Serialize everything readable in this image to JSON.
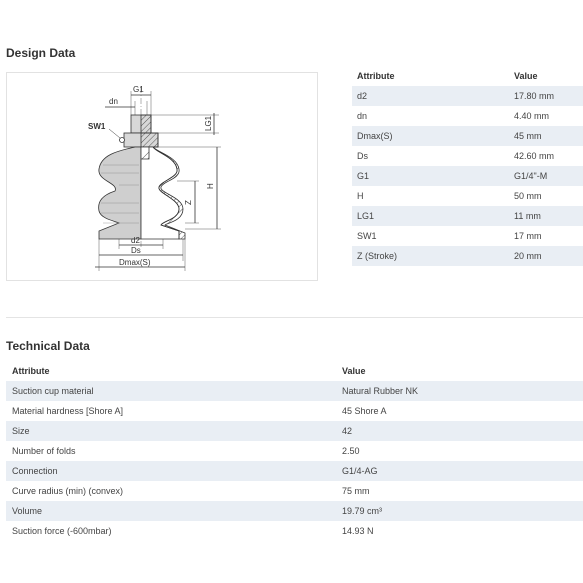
{
  "design": {
    "title": "Design Data",
    "header": {
      "attribute": "Attribute",
      "value": "Value"
    },
    "rows": [
      {
        "attribute": "d2",
        "value": "17.80 mm"
      },
      {
        "attribute": "dn",
        "value": "4.40 mm"
      },
      {
        "attribute": "Dmax(S)",
        "value": "45 mm"
      },
      {
        "attribute": "Ds",
        "value": "42.60 mm"
      },
      {
        "attribute": "G1",
        "value": "G1/4\"-M"
      },
      {
        "attribute": "H",
        "value": "50 mm"
      },
      {
        "attribute": "LG1",
        "value": "11 mm"
      },
      {
        "attribute": "SW1",
        "value": "17 mm"
      },
      {
        "attribute": "Z (Stroke)",
        "value": "20 mm"
      }
    ],
    "diagram_labels": {
      "g1": "G1",
      "dn": "dn",
      "sw1": "SW1",
      "lg1": "LG1",
      "h": "H",
      "z": "Z",
      "d2": "d2",
      "ds": "Ds",
      "dmax": "Dmax(S)"
    }
  },
  "technical": {
    "title": "Technical Data",
    "header": {
      "attribute": "Attribute",
      "value": "Value"
    },
    "rows": [
      {
        "attribute": "Suction cup material",
        "value": "Natural Rubber NK"
      },
      {
        "attribute": "Material hardness [Shore A]",
        "value": "45 Shore A"
      },
      {
        "attribute": "Size",
        "value": "42"
      },
      {
        "attribute": "Number of folds",
        "value": "2.50"
      },
      {
        "attribute": "Connection",
        "value": "G1/4-AG"
      },
      {
        "attribute": "Curve radius (min) (convex)",
        "value": "75 mm"
      },
      {
        "attribute": "Volume",
        "value": "19.79 cm³"
      },
      {
        "attribute": "Suction force (-600mbar)",
        "value": "14.93 N"
      }
    ]
  },
  "colors": {
    "row_stripe": "#e9eef4",
    "text": "#333333",
    "drawing_gray": "#cfcfcf"
  }
}
